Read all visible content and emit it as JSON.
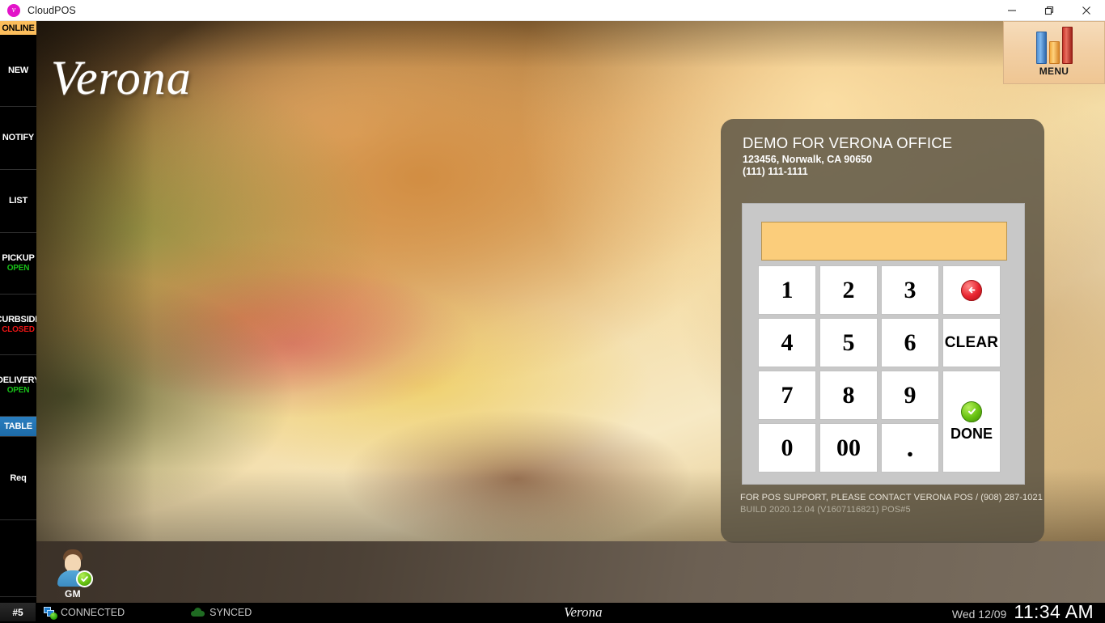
{
  "window": {
    "title": "CloudPOS",
    "logo_icon": "cloudpos-logo-icon",
    "minimize_label": "minimize-icon",
    "maximize_label": "restore-icon",
    "close_label": "close-icon"
  },
  "sidebar": {
    "online_badge": "ONLINE",
    "items": [
      {
        "label": "NEW",
        "status": "",
        "selected": false
      },
      {
        "label": "NOTIFY",
        "status": "",
        "selected": false
      },
      {
        "label": "LIST",
        "status": "",
        "selected": false
      },
      {
        "label": "PICKUP",
        "status": "OPEN",
        "selected": false
      },
      {
        "label": "CURBSIDE",
        "status": "CLOSED",
        "selected": false
      },
      {
        "label": "DELIVERY",
        "status": "OPEN",
        "selected": false
      },
      {
        "label": "TABLE",
        "status": "",
        "selected": true
      },
      {
        "label": "Req",
        "status": "",
        "selected": false
      }
    ],
    "status_colors": {
      "open": "#18c018",
      "closed": "#e81414"
    }
  },
  "brand": {
    "logo_text": "Verona",
    "footer_logo_text": "Verona"
  },
  "menu_button": {
    "label": "MENU",
    "icon": "bar-chart-icon",
    "bar_colors": [
      "#4f8fd4",
      "#f0a83c",
      "#c9352b"
    ]
  },
  "panel": {
    "store_name": "DEMO FOR VERONA OFFICE",
    "store_address": "123456, Norwalk, CA 90650",
    "store_phone": "(111) 111-1111",
    "display_value": "",
    "keys": [
      {
        "label": "1",
        "type": "digit"
      },
      {
        "label": "2",
        "type": "digit"
      },
      {
        "label": "3",
        "type": "digit"
      },
      {
        "label": "",
        "type": "back",
        "icon": "back-arrow-icon"
      },
      {
        "label": "4",
        "type": "digit"
      },
      {
        "label": "5",
        "type": "digit"
      },
      {
        "label": "6",
        "type": "digit"
      },
      {
        "label": "CLEAR",
        "type": "word"
      },
      {
        "label": "7",
        "type": "digit"
      },
      {
        "label": "8",
        "type": "digit"
      },
      {
        "label": "9",
        "type": "digit"
      },
      {
        "label": "DONE",
        "type": "done",
        "icon": "check-circle-icon"
      },
      {
        "label": "0",
        "type": "digit"
      },
      {
        "label": "00",
        "type": "digit"
      },
      {
        "label": ".",
        "type": "dot"
      }
    ],
    "support_line": "FOR POS SUPPORT, PLEASE CONTACT VERONA POS / (908) 287-1021",
    "build_line": "BUILD 2020.12.04 (V1607116821) POS#5",
    "display_bg": "#fbcd7b"
  },
  "user": {
    "name": "GM",
    "avatar_icon": "user-avatar-icon",
    "status_icon": "check-circle-icon"
  },
  "statusbar": {
    "pos_number": "#5",
    "connection_label": "CONNECTED",
    "connection_icon": "network-icon",
    "sync_label": "SYNCED",
    "sync_icon": "cloud-icon",
    "date": "Wed 12/09",
    "time": "11:34 AM"
  }
}
